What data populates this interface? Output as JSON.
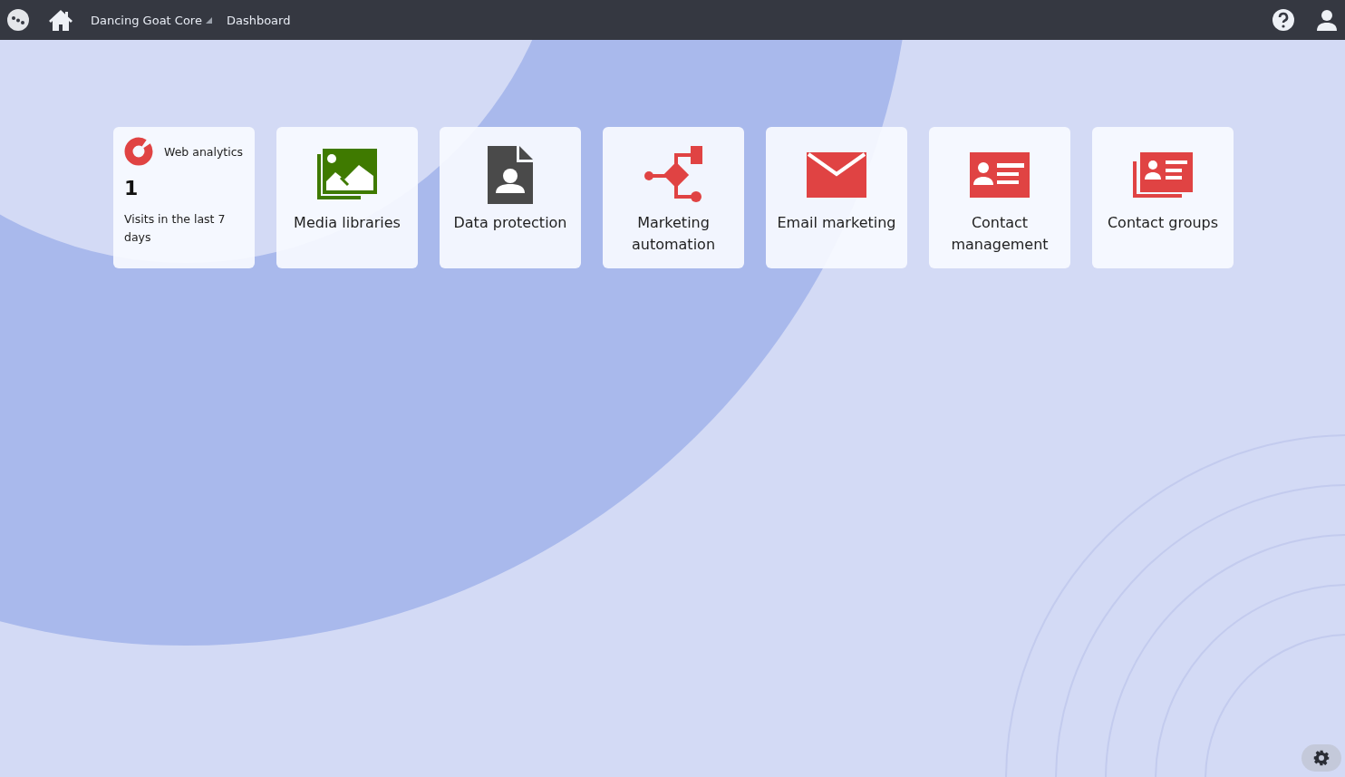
{
  "header": {
    "site": "Dancing Goat Core",
    "page": "Dashboard"
  },
  "tiles": [
    {
      "kind": "widget",
      "title": "Web analytics",
      "value": "1",
      "caption": "Visits in the last 7 days"
    },
    {
      "kind": "app",
      "label": "Media libraries"
    },
    {
      "kind": "app",
      "label": "Data protection"
    },
    {
      "kind": "app",
      "label": "Marketing automation"
    },
    {
      "kind": "app",
      "label": "Email marketing"
    },
    {
      "kind": "app",
      "label": "Contact management"
    },
    {
      "kind": "app",
      "label": "Contact groups"
    }
  ]
}
